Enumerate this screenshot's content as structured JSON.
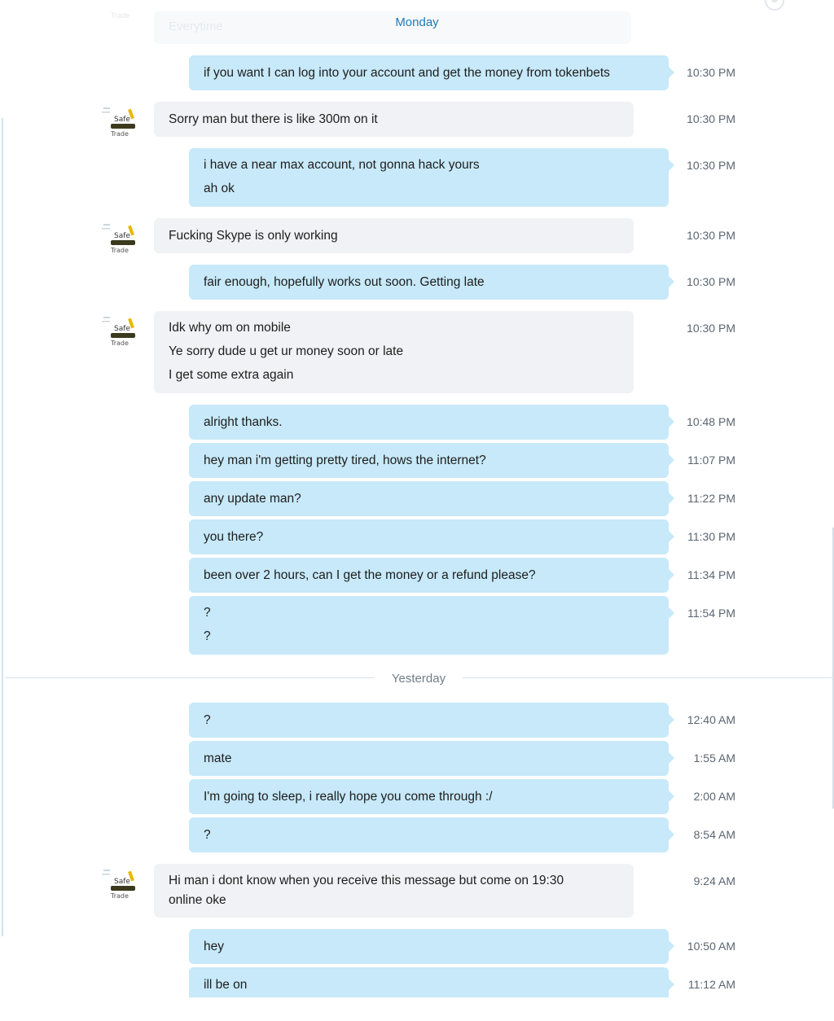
{
  "conversation": {
    "ghost_text": "Everytime",
    "ghost_avatar_text": "Trade",
    "days": {
      "monday": "Monday",
      "yesterday": "Yesterday"
    },
    "contact": {
      "avatar_text_top": "Safe",
      "avatar_text_bottom": "Trade"
    },
    "messages": [
      {
        "direction": "out",
        "lines": [
          "if you want I can log into your account and get the money from tokenbets"
        ],
        "time": "10:30 PM"
      },
      {
        "direction": "in",
        "lines": [
          "Sorry man but there is like 300m on it"
        ],
        "time": "10:30 PM"
      },
      {
        "direction": "out",
        "lines": [
          "i have a near max account, not gonna hack yours",
          "ah ok"
        ],
        "time": "10:30 PM"
      },
      {
        "direction": "in",
        "lines": [
          "Fucking Skype is only working"
        ],
        "time": "10:30 PM"
      },
      {
        "direction": "out",
        "lines": [
          "fair enough, hopefully works out soon. Getting late"
        ],
        "time": "10:30 PM"
      },
      {
        "direction": "in",
        "lines": [
          "Idk why om on mobile",
          "Ye sorry dude u get ur money soon or late",
          "I get some extra again"
        ],
        "time": "10:30 PM"
      },
      {
        "direction": "out",
        "lines": [
          "alright thanks."
        ],
        "time": "10:48 PM"
      },
      {
        "direction": "out",
        "lines": [
          "hey man i'm getting pretty tired, hows the internet?"
        ],
        "time": "11:07 PM"
      },
      {
        "direction": "out",
        "lines": [
          "any update man?"
        ],
        "time": "11:22 PM"
      },
      {
        "direction": "out",
        "lines": [
          "you there?"
        ],
        "time": "11:30 PM"
      },
      {
        "direction": "out",
        "lines": [
          "been over 2 hours, can I get the money or a refund please?"
        ],
        "time": "11:34 PM"
      },
      {
        "direction": "out",
        "lines": [
          "?",
          "?"
        ],
        "time": "11:54 PM"
      },
      {
        "direction": "out",
        "lines": [
          "?"
        ],
        "time": "12:40 AM"
      },
      {
        "direction": "out",
        "lines": [
          "mate"
        ],
        "time": "1:55 AM"
      },
      {
        "direction": "out",
        "lines": [
          "I'm going to sleep, i really hope you come through :/"
        ],
        "time": "2:00 AM"
      },
      {
        "direction": "out",
        "lines": [
          "?"
        ],
        "time": "8:54 AM"
      },
      {
        "direction": "in",
        "lines": [
          "Hi man i dont know when you receive this message but come on 19:30",
          "online oke"
        ],
        "time": "9:24 AM"
      },
      {
        "direction": "out",
        "lines": [
          "hey"
        ],
        "time": "10:50 AM"
      },
      {
        "direction": "out",
        "lines": [
          "ill be on"
        ],
        "time": "11:12 AM"
      }
    ]
  },
  "colors": {
    "outgoing_bubble": "#c7e9f9",
    "incoming_bubble": "#f0f2f5",
    "day_accent": "#1f7ab8"
  }
}
